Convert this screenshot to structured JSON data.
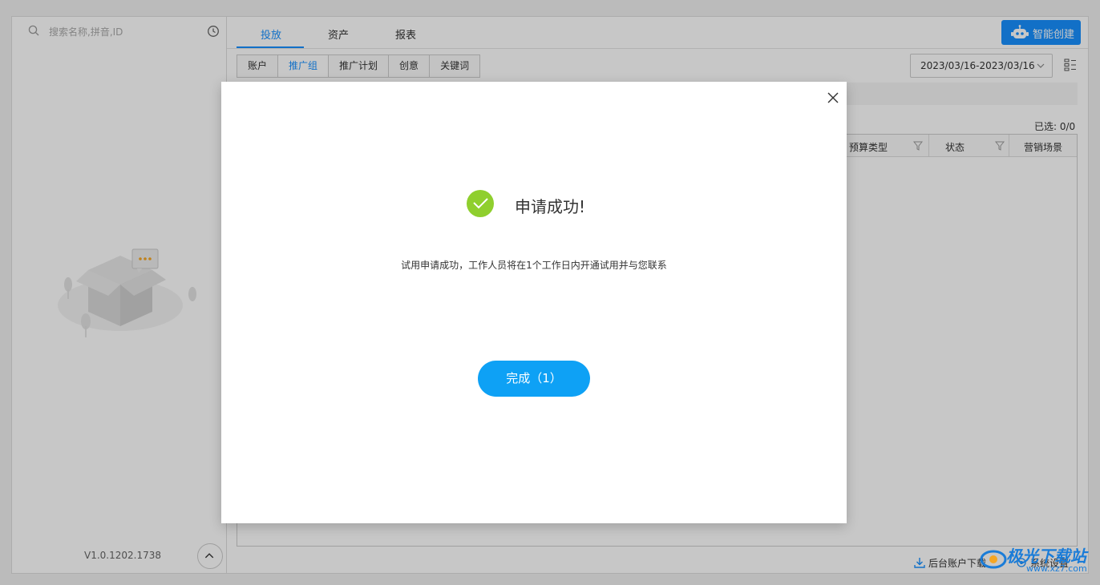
{
  "sidebar": {
    "search_placeholder": "搜索名称,拼音,ID",
    "version": "V1.0.1202.1738"
  },
  "top_tabs": [
    {
      "label": "投放",
      "active": true
    },
    {
      "label": "资产",
      "active": false
    },
    {
      "label": "报表",
      "active": false
    }
  ],
  "smart_create_label": "智能创建",
  "sub_tabs": [
    {
      "label": "账户",
      "active": false
    },
    {
      "label": "推广组",
      "active": true
    },
    {
      "label": "推广计划",
      "active": false
    },
    {
      "label": "创意",
      "active": false
    },
    {
      "label": "关键词",
      "active": false
    }
  ],
  "date_range": "2023/03/16-2023/03/16",
  "selected_count": "已选: 0/0",
  "table_headers": [
    "预算类型",
    "状态",
    "营销场景"
  ],
  "footer": {
    "download_label": "后台账户下载",
    "settings_label": "系统设置"
  },
  "modal": {
    "title": "申请成功!",
    "message": "试用申请成功，工作人员将在1个工作日内开通试用并与您联系",
    "done_button": "完成（1）"
  },
  "watermark": {
    "text": "极光下载站",
    "sub": "www.xz7.com"
  },
  "colors": {
    "accent": "#1890ff",
    "done_button": "#0ea1f5",
    "success": "#8fcf2e"
  }
}
